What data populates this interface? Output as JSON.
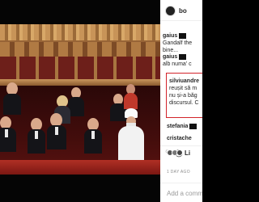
{
  "post": {
    "author": "bo",
    "date": "1 DAY AGO",
    "likes_text": "Li"
  },
  "comments": [
    {
      "user": "gaius",
      "lines": [
        "Gandalf the",
        "bine..."
      ]
    },
    {
      "user": "gaius",
      "lines": [
        "alb numa' c"
      ]
    },
    {
      "user": "silviuandre",
      "lines": [
        "reușit să m",
        "nu și-a băg",
        "discursul. C"
      ]
    },
    {
      "user": "stefania",
      "lines": []
    },
    {
      "user": "cristache",
      "lines": []
    }
  ],
  "add_comment": {
    "placeholder": "Add a comm"
  },
  "colors": {
    "highlight": "#d2232a",
    "username": "#262626",
    "meta": "#8e8e8e"
  }
}
